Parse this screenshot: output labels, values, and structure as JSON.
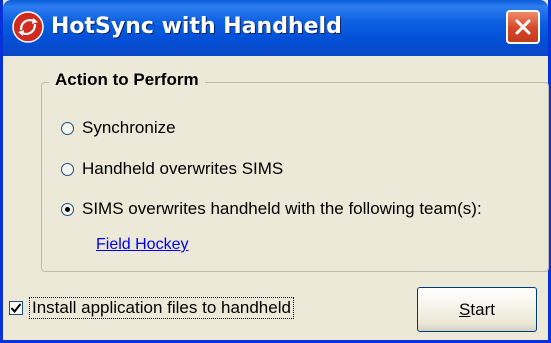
{
  "window": {
    "title": "HotSync with Handheld"
  },
  "group": {
    "legend": "Action to Perform",
    "options": [
      {
        "label": "Synchronize",
        "selected": false
      },
      {
        "label": "Handheld overwrites SIMS",
        "selected": false
      },
      {
        "label": "SIMS overwrites handheld with the following team(s):",
        "selected": true
      }
    ],
    "team_link": "Field Hockey"
  },
  "install_checkbox": {
    "label": "Install application files to handheld",
    "checked": true
  },
  "start_button": {
    "accel": "S",
    "rest": "tart"
  },
  "icons": {
    "app": "hotsync-icon",
    "close": "close-icon"
  },
  "colors": {
    "titlebar": "#0350d6",
    "close": "#d3472a",
    "link": "#0000ee",
    "dialog_bg": "#ece9d8"
  }
}
